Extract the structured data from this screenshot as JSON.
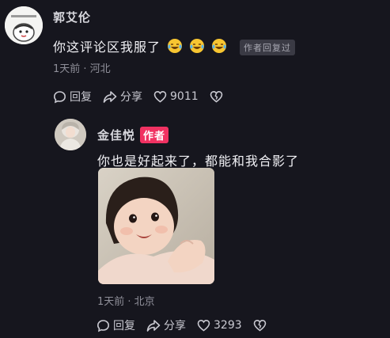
{
  "comment": {
    "username": "郭艾伦",
    "text": "你这评论区我服了",
    "emojis": [
      "laughing-tears-icon",
      "laughing-tears-icon",
      "laughing-tears-icon"
    ],
    "author_replied_label": "作者回复过",
    "meta": "1天前 · 河北",
    "reply_label": "回复",
    "share_label": "分享",
    "like_count": "9011"
  },
  "reply": {
    "username": "金佳悦",
    "author_badge": "作者",
    "text": "你也是好起来了，都能和我合影了",
    "meta": "1天前 · 北京",
    "reply_label": "回复",
    "share_label": "分享",
    "like_count": "3293"
  },
  "colors": {
    "background": "#16161e",
    "author_badge": "#f03262",
    "meta_text": "#8f8f99"
  }
}
